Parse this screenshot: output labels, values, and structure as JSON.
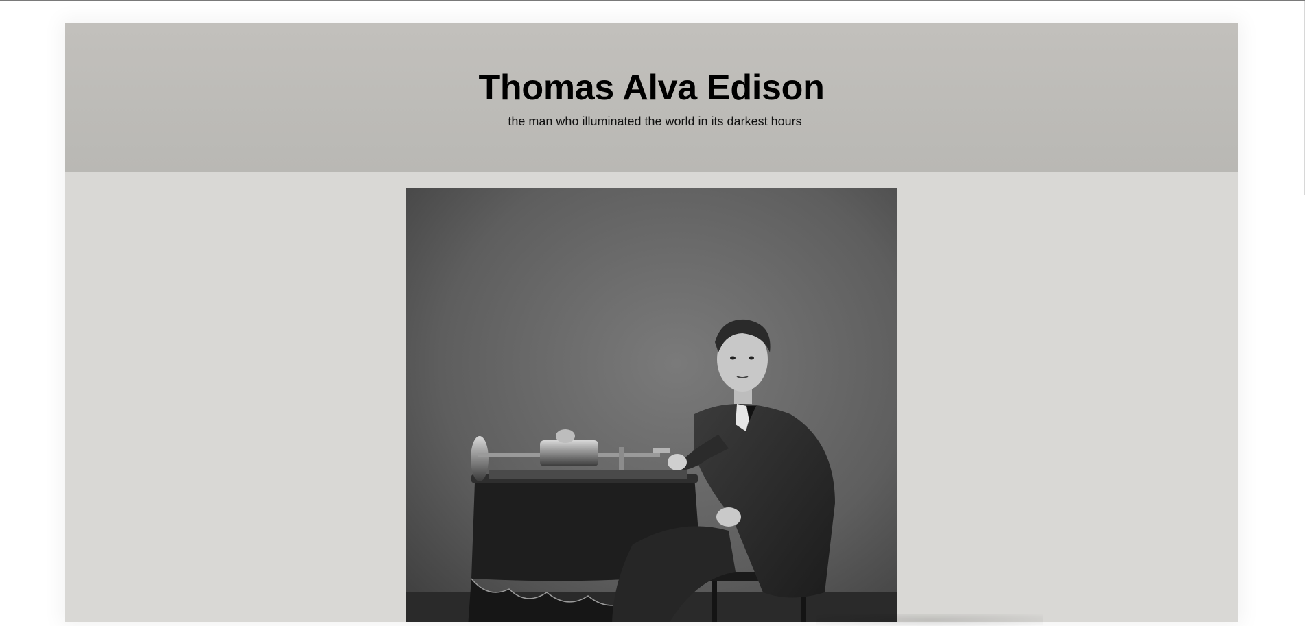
{
  "header": {
    "title": "Thomas Alva Edison",
    "subtitle": "the man who illuminated the world in its darkest hours"
  },
  "main": {
    "image": {
      "alt": "Thomas Alva Edison"
    }
  },
  "colors": {
    "header_bg": "#bebcb8",
    "page_bg": "#d9d8d5",
    "photo_bg": "#6b6b6b"
  }
}
